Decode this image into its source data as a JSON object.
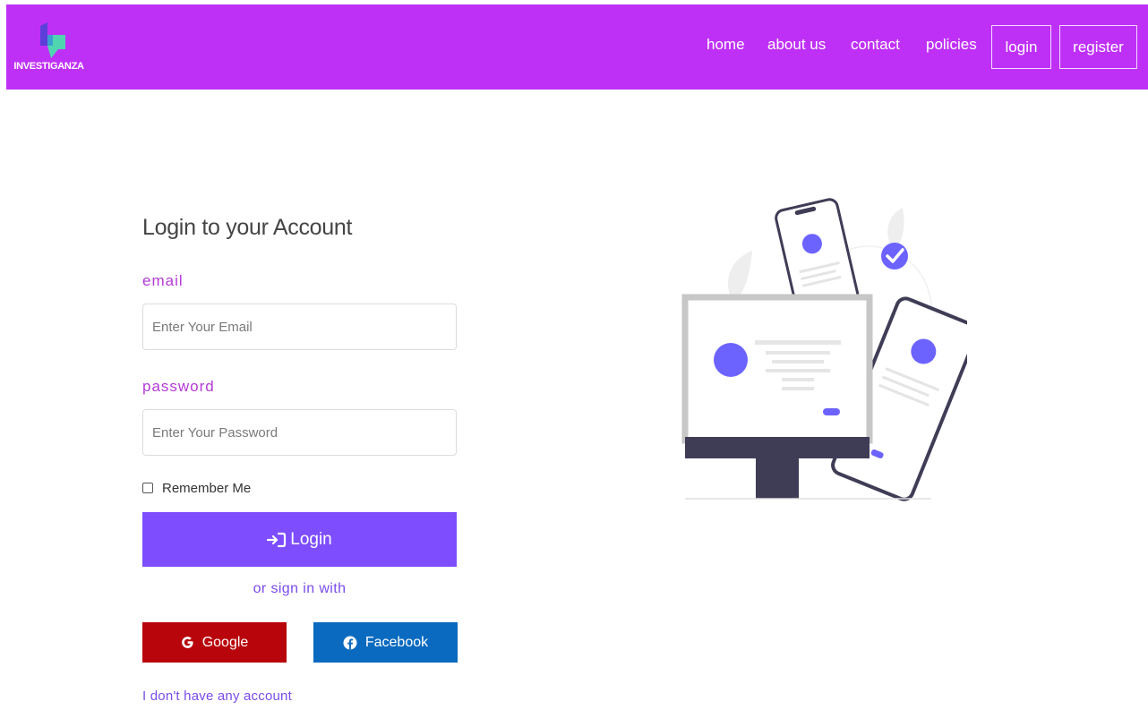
{
  "brand": {
    "name": "INVESTIGANZA"
  },
  "nav": {
    "links": [
      "home",
      "about us",
      "contact",
      "policies"
    ],
    "login_label": "login",
    "register_label": "register"
  },
  "form": {
    "title": "Login to your Account",
    "email_label": "email",
    "email_placeholder": "Enter Your Email",
    "email_value": "",
    "password_label": "password",
    "password_placeholder": "Enter Your Password",
    "password_value": "",
    "remember_label": "Remember Me",
    "remember_checked": false,
    "login_label": "Login",
    "or_sign_in": "or sign in with",
    "google_label": "Google",
    "facebook_label": "Facebook",
    "no_account_link": "I don't have any account"
  },
  "icons": {
    "login_button": "sign-in-icon",
    "google_button": "google-icon",
    "facebook_button": "facebook-icon"
  },
  "colors": {
    "navbar": "#bf30f7",
    "primary": "#7d4dfe",
    "label": "#b43ad6",
    "google": "#b8050b",
    "facebook": "#0a6abf",
    "illustration_accent": "#6c63ff"
  }
}
